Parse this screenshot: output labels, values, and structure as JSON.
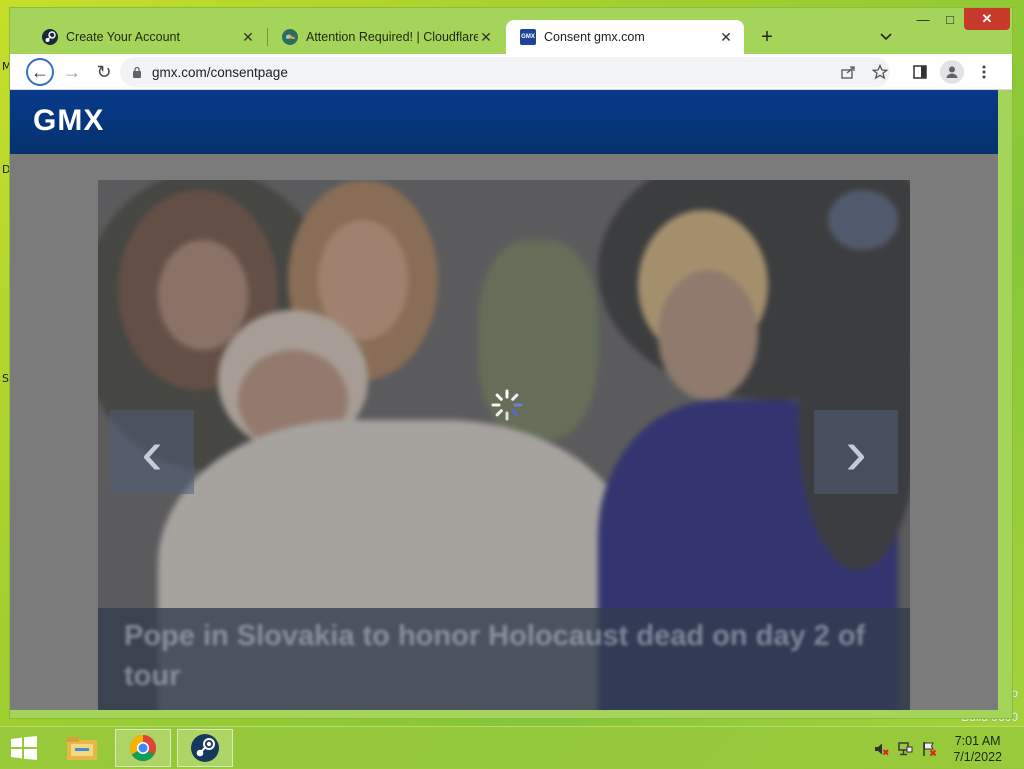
{
  "desktop": {
    "edge_letters": [
      "M",
      "D",
      "S"
    ],
    "watermark": [
      "o",
      "Build 9600"
    ]
  },
  "browser": {
    "tabs": [
      {
        "title": "Create Your Account",
        "icon": "steam-icon",
        "active": false
      },
      {
        "title": "Attention Required! | Cloudflare",
        "icon": "cloudflare-icon",
        "active": false
      },
      {
        "title": "Consent gmx.com",
        "icon": "gmx-icon",
        "active": true
      }
    ],
    "favicon_text": {
      "gmx": "GMX"
    },
    "new_tab_glyph": "+",
    "tab_search_glyph": "⌄",
    "window_controls": {
      "minimize": "—",
      "maximize": "□",
      "close": "✕"
    },
    "url": "gmx.com/consentpage",
    "nav": {
      "back": "←",
      "forward": "→",
      "reload": "↻"
    },
    "toolbar_icons": [
      "share-icon",
      "star-icon",
      "side-panel-icon",
      "profile-icon",
      "menu-icon"
    ]
  },
  "page": {
    "logo": "GMX",
    "carousel": {
      "caption": "Pope in Slovakia to honor Holocaust dead on day 2 of tour",
      "prev_glyph": "‹",
      "next_glyph": "›"
    },
    "colors": {
      "header": "#083a8a",
      "overlay": "#7b7b7b"
    }
  },
  "taskbar": {
    "apps": [
      "file-explorer-icon",
      "chrome-icon",
      "steam-icon"
    ],
    "time": "7:01 AM",
    "date": "7/1/2022"
  }
}
